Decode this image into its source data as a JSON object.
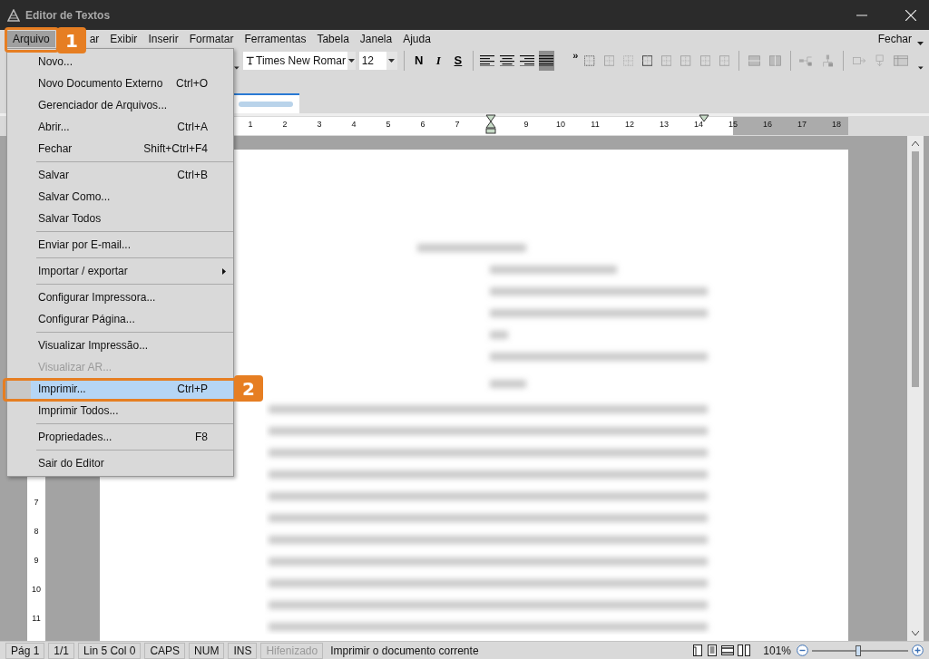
{
  "window": {
    "title": "Editor de Textos"
  },
  "menubar": {
    "items": [
      {
        "label": "Arquivo",
        "selected": true
      },
      {
        "label": "ar",
        "selected": false
      },
      {
        "label": "Exibir",
        "selected": false
      },
      {
        "label": "Inserir",
        "selected": false
      },
      {
        "label": "Formatar",
        "selected": false
      },
      {
        "label": "Ferramentas",
        "selected": false
      },
      {
        "label": "Tabela",
        "selected": false
      },
      {
        "label": "Janela",
        "selected": false
      },
      {
        "label": "Ajuda",
        "selected": false
      }
    ],
    "close_label": "Fechar"
  },
  "toolbar": {
    "font": "Times New Romar",
    "size": "12",
    "format_buttons": [
      "N",
      "I",
      "S"
    ],
    "align_buttons": [
      {
        "selected": false
      },
      {
        "selected": false
      },
      {
        "selected": false
      },
      {
        "selected": true
      }
    ],
    "overflow": "»"
  },
  "ruler": {
    "numbers": [
      "1",
      "2",
      "3",
      "4",
      "5",
      "6",
      "7",
      "9",
      "10",
      "11",
      "12",
      "13",
      "14",
      "15",
      "16",
      "17",
      "18"
    ]
  },
  "vertical_ruler": {
    "numbers": [
      "7",
      "8",
      "9",
      "10",
      "11"
    ]
  },
  "file_menu": {
    "items": [
      {
        "kind": "item",
        "label": "Novo...",
        "disabled": false,
        "selected": false,
        "submenu": false
      },
      {
        "kind": "item",
        "label": "Novo Documento Externo",
        "shortcut": "Ctrl+O",
        "disabled": false,
        "selected": false,
        "submenu": false
      },
      {
        "kind": "item",
        "label": "Gerenciador de Arquivos...",
        "disabled": false,
        "selected": false,
        "submenu": false
      },
      {
        "kind": "item",
        "label": "Abrir...",
        "shortcut": "Ctrl+A",
        "disabled": false,
        "selected": false,
        "submenu": false
      },
      {
        "kind": "item",
        "label": "Fechar",
        "shortcut": "Shift+Ctrl+F4",
        "disabled": false,
        "selected": false,
        "submenu": false
      },
      {
        "kind": "separator"
      },
      {
        "kind": "item",
        "label": "Salvar",
        "shortcut": "Ctrl+B",
        "disabled": false,
        "selected": false,
        "submenu": false
      },
      {
        "kind": "item",
        "label": "Salvar Como...",
        "disabled": false,
        "selected": false,
        "submenu": false
      },
      {
        "kind": "item",
        "label": "Salvar Todos",
        "disabled": false,
        "selected": false,
        "submenu": false
      },
      {
        "kind": "separator"
      },
      {
        "kind": "item",
        "label": "Enviar por E-mail...",
        "disabled": false,
        "selected": false,
        "submenu": false
      },
      {
        "kind": "separator"
      },
      {
        "kind": "item",
        "label": "Importar / exportar",
        "disabled": false,
        "selected": false,
        "submenu": true
      },
      {
        "kind": "separator"
      },
      {
        "kind": "item",
        "label": "Configurar Impressora...",
        "disabled": false,
        "selected": false,
        "submenu": false
      },
      {
        "kind": "item",
        "label": "Configurar Página...",
        "disabled": false,
        "selected": false,
        "submenu": false
      },
      {
        "kind": "separator"
      },
      {
        "kind": "item",
        "label": "Visualizar Impressão...",
        "disabled": false,
        "selected": false,
        "submenu": false
      },
      {
        "kind": "item",
        "label": "Visualizar AR...",
        "disabled": true,
        "selected": false,
        "submenu": false
      },
      {
        "kind": "item",
        "label": "Imprimir...",
        "shortcut": "Ctrl+P",
        "disabled": false,
        "selected": true,
        "submenu": false
      },
      {
        "kind": "item",
        "label": "Imprimir Todos...",
        "disabled": false,
        "selected": false,
        "submenu": false
      },
      {
        "kind": "separator"
      },
      {
        "kind": "item",
        "label": "Propriedades...",
        "shortcut": "F8",
        "disabled": false,
        "selected": false,
        "submenu": false
      },
      {
        "kind": "separator"
      },
      {
        "kind": "item",
        "label": "Sair do Editor",
        "disabled": false,
        "selected": false,
        "submenu": false
      }
    ]
  },
  "callouts": [
    {
      "label": "1"
    },
    {
      "label": "2"
    }
  ],
  "status_bar": {
    "fields": [
      {
        "text": "Pág 1",
        "disabled": false
      },
      {
        "text": "1/1",
        "disabled": false
      },
      {
        "text": "Lin 5  Col 0",
        "disabled": false
      },
      {
        "text": "CAPS",
        "disabled": false
      },
      {
        "text": "NUM",
        "disabled": false
      },
      {
        "text": "INS",
        "disabled": false
      },
      {
        "text": "Hifenizado",
        "disabled": true
      }
    ],
    "message": "Imprimir o documento corrente",
    "zoom": "101%",
    "zoom_level": {
      "level": 0.48
    }
  }
}
